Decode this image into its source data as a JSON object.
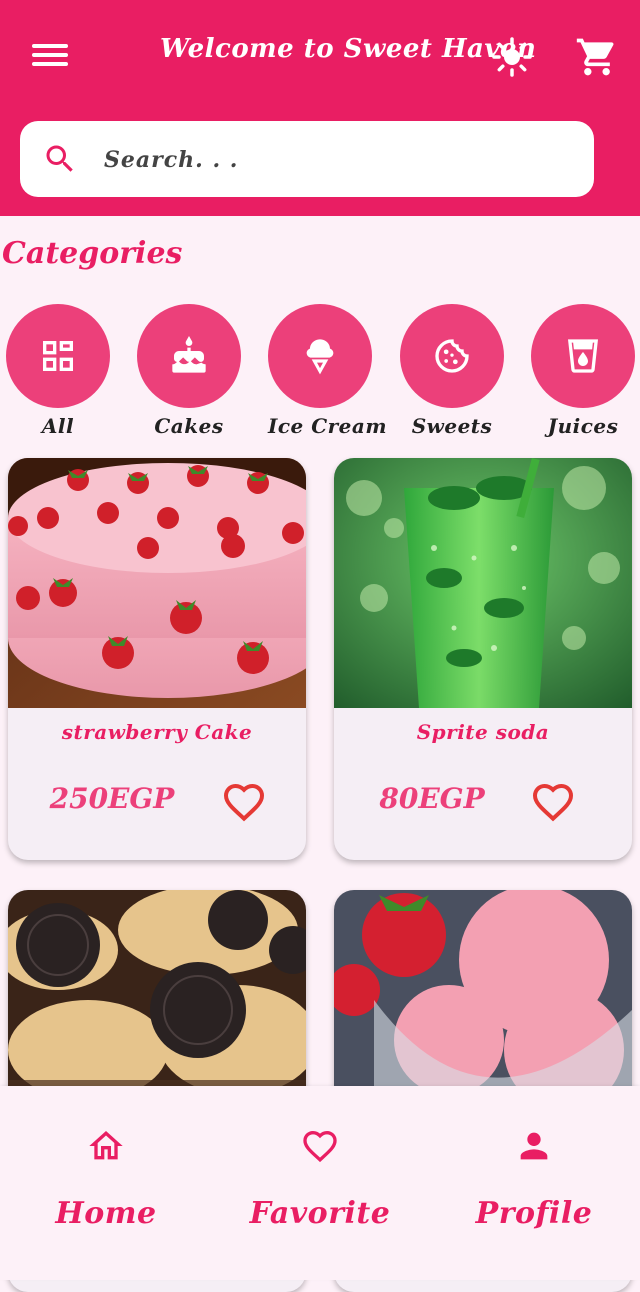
{
  "app": {
    "title": "Welcome to Sweet Haven",
    "accent_color": "#e91e63",
    "icons": {
      "menu": "menu-icon",
      "theme": "sun-icon",
      "cart": "cart-icon",
      "search": "search-icon"
    }
  },
  "search": {
    "placeholder": "Search. . ."
  },
  "categories": {
    "title": "Categories",
    "items": [
      {
        "label": "All",
        "icon": "grid-icon"
      },
      {
        "label": "Cakes",
        "icon": "cake-icon"
      },
      {
        "label": "Ice Cream",
        "icon": "ice-cream-icon"
      },
      {
        "label": "Sweets",
        "icon": "cookie-icon"
      },
      {
        "label": "Juices",
        "icon": "drink-icon"
      }
    ]
  },
  "products": [
    {
      "name": "strawberry Cake",
      "price": "250EGP",
      "image": "strawberry-cake-photo",
      "favorite": false
    },
    {
      "name": "Sprite soda",
      "price": "80EGP",
      "image": "sprite-soda-photo",
      "favorite": false
    },
    {
      "name": "",
      "price": "",
      "image": "oreo-cupcakes-photo"
    },
    {
      "name": "",
      "price": "",
      "image": "strawberry-ice-cream-photo"
    }
  ],
  "bottom_nav": {
    "items": [
      {
        "label": "Home",
        "icon": "home-icon"
      },
      {
        "label": "Favorite",
        "icon": "heart-icon"
      },
      {
        "label": "Profile",
        "icon": "person-icon"
      }
    ]
  }
}
